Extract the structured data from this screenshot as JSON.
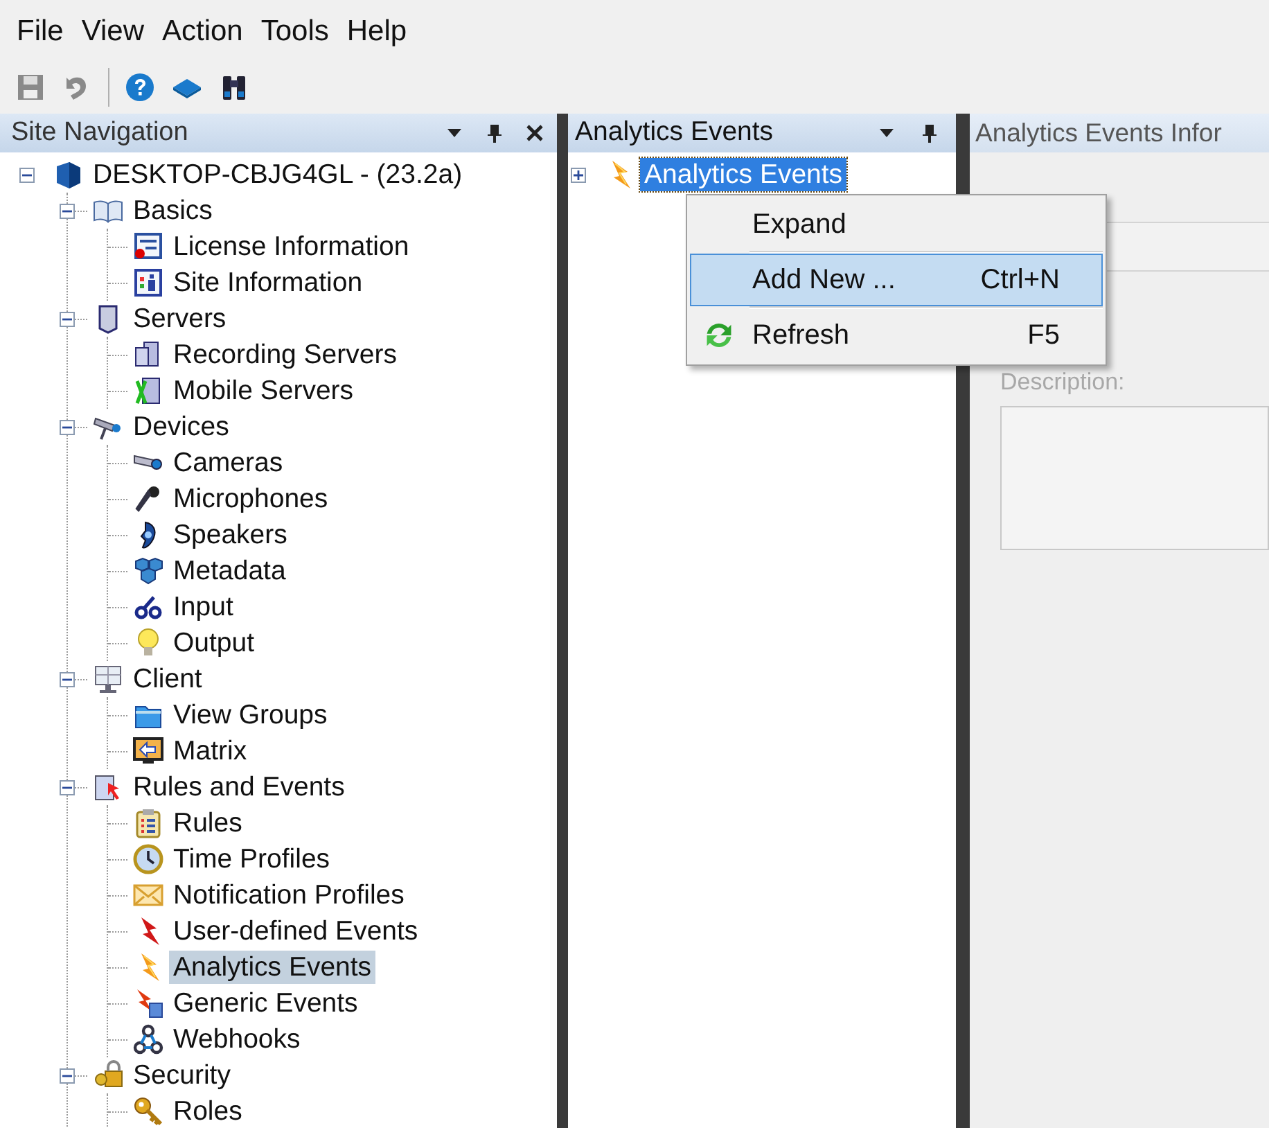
{
  "menu_bar": [
    "File",
    "View",
    "Action",
    "Tools",
    "Help"
  ],
  "toolbar": [
    {
      "disabled": true
    },
    {
      "disabled": true
    },
    {
      "disabled": false
    },
    {
      "disabled": false
    },
    {
      "disabled": false
    }
  ],
  "site_navigation": {
    "title": "Site Navigation",
    "tree": [
      {
        "label": "DESKTOP-CBJG4GL - (23.2a)",
        "expanded": true,
        "selected": false,
        "children": [
          {
            "label": "Basics",
            "expanded": true,
            "selected": false,
            "children": [
              {
                "label": "License Information",
                "selected": false
              },
              {
                "label": "Site Information",
                "selected": false
              }
            ]
          },
          {
            "label": "Servers",
            "expanded": true,
            "selected": false,
            "children": [
              {
                "label": "Recording Servers",
                "selected": false
              },
              {
                "label": "Mobile Servers",
                "selected": false
              }
            ]
          },
          {
            "label": "Devices",
            "expanded": true,
            "selected": false,
            "children": [
              {
                "label": "Cameras",
                "selected": false
              },
              {
                "label": "Microphones",
                "selected": false
              },
              {
                "label": "Speakers",
                "selected": false
              },
              {
                "label": "Metadata",
                "selected": false
              },
              {
                "label": "Input",
                "selected": false
              },
              {
                "label": "Output",
                "selected": false
              }
            ]
          },
          {
            "label": "Client",
            "expanded": true,
            "selected": false,
            "children": [
              {
                "label": "View Groups",
                "selected": false
              },
              {
                "label": "Matrix",
                "selected": false
              }
            ]
          },
          {
            "label": "Rules and Events",
            "expanded": true,
            "selected": false,
            "children": [
              {
                "label": "Rules",
                "selected": false
              },
              {
                "label": "Time Profiles",
                "selected": false
              },
              {
                "label": "Notification Profiles",
                "selected": false
              },
              {
                "label": "User-defined Events",
                "selected": false
              },
              {
                "label": "Analytics Events",
                "selected": true
              },
              {
                "label": "Generic Events",
                "selected": false
              },
              {
                "label": "Webhooks",
                "selected": false
              }
            ]
          },
          {
            "label": "Security",
            "expanded": true,
            "selected": false,
            "children": [
              {
                "label": "Roles",
                "selected": false
              }
            ]
          }
        ]
      }
    ]
  },
  "analytics_pane": {
    "title": "Analytics Events",
    "tree": [
      {
        "label": "Analytics Events",
        "expanded": false,
        "selected": true
      }
    ]
  },
  "info_pane": {
    "title": "Analytics Events Infor",
    "description": {
      "label": "Description:",
      "disabled": true
    }
  },
  "context_menu": [
    {
      "label": "Expand",
      "selected": false
    },
    {
      "label": "Add New ...",
      "shortcut": "Ctrl+N",
      "selected": true
    },
    {
      "label": "Refresh",
      "shortcut": "F5",
      "selected": false
    }
  ]
}
